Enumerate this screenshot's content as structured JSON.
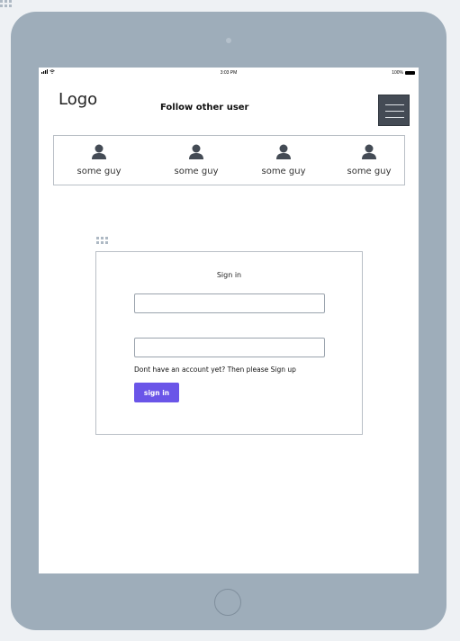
{
  "status_bar": {
    "time": "3:03 PM",
    "battery_percent": "100%"
  },
  "header": {
    "logo": "Logo",
    "title": "Follow other user",
    "menu_icon": "hamburger-icon"
  },
  "users": [
    {
      "name": "some guy",
      "icon": "user-icon"
    },
    {
      "name": "some guy",
      "icon": "user-icon"
    },
    {
      "name": "some guy",
      "icon": "user-icon"
    },
    {
      "name": "some guy",
      "icon": "user-icon"
    }
  ],
  "signin": {
    "title": "Sign in",
    "username_value": "",
    "password_value": "",
    "signup_prompt": "Dont have an account yet? Then please Sign up",
    "button_label": "sign in"
  },
  "colors": {
    "device_frame": "#9eadba",
    "menu_button": "#444b55",
    "primary_button": "#6a55e8"
  }
}
